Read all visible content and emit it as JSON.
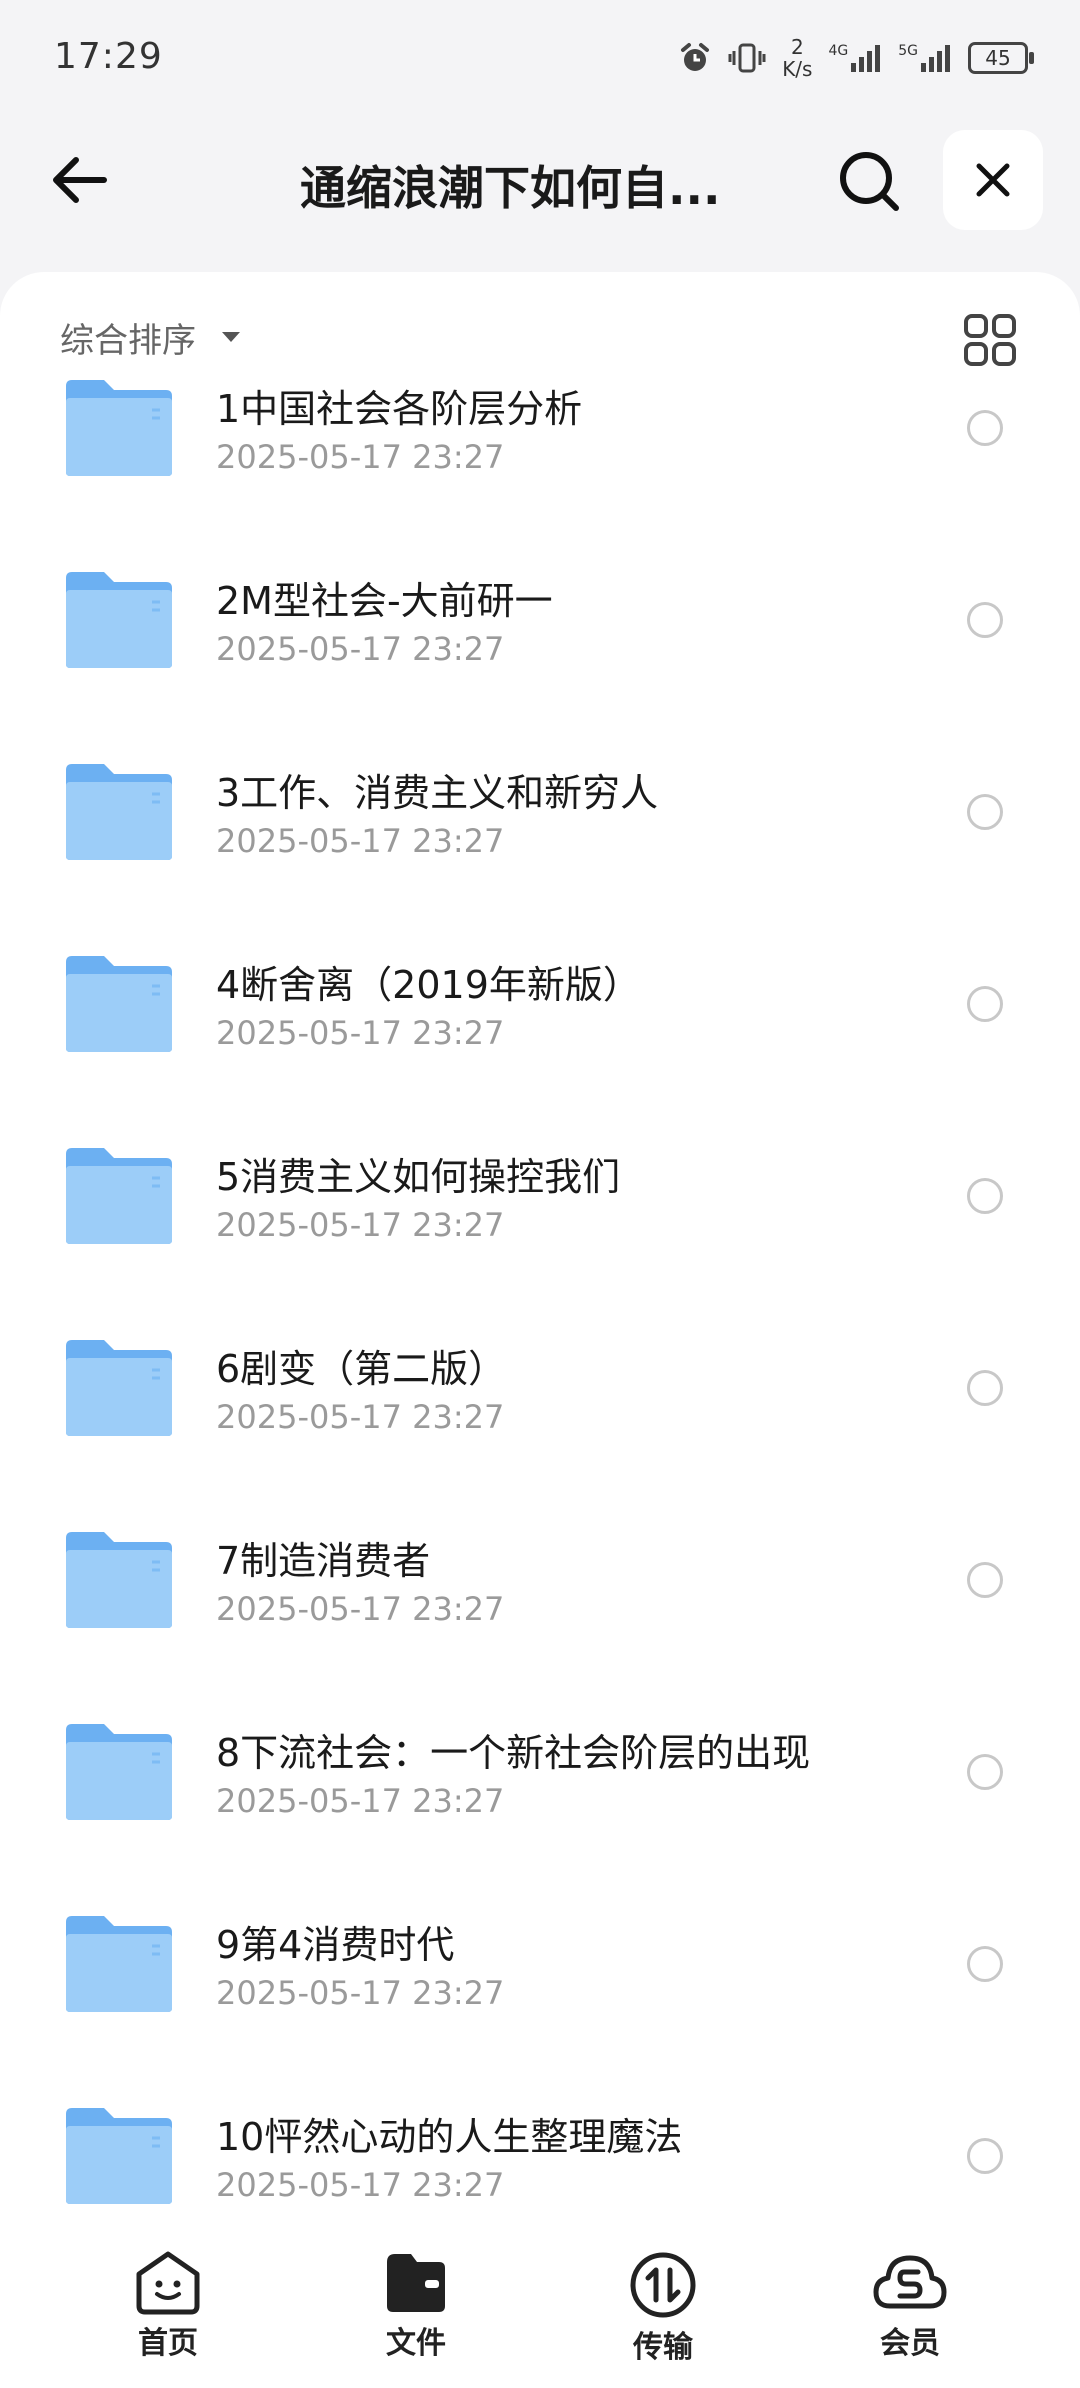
{
  "status_bar": {
    "time": "17:29",
    "net_speed_value": "2",
    "net_speed_unit": "K/s",
    "signal1_label": "4G",
    "signal2_label": "5G",
    "battery": "45"
  },
  "header": {
    "title": "通缩浪潮下如何自...",
    "icons": [
      "back-arrow-icon",
      "search-icon",
      "close-icon"
    ]
  },
  "toolbar": {
    "sort_label": "综合排序",
    "view_toggle_icon": "grid-view-icon"
  },
  "files": [
    {
      "name": "1中国社会各阶层分析",
      "date": "2025-05-17 23:27"
    },
    {
      "name": "2M型社会-大前研一",
      "date": "2025-05-17 23:27"
    },
    {
      "name": "3工作、消费主义和新穷人",
      "date": "2025-05-17 23:27"
    },
    {
      "name": "4断舍离（2019年新版）",
      "date": "2025-05-17 23:27"
    },
    {
      "name": "5消费主义如何操控我们",
      "date": "2025-05-17 23:27"
    },
    {
      "name": "6剧变（第二版）",
      "date": "2025-05-17 23:27"
    },
    {
      "name": "7制造消费者",
      "date": "2025-05-17 23:27"
    },
    {
      "name": "8下流社会：一个新社会阶层的出现",
      "date": "2025-05-17 23:27"
    },
    {
      "name": "9第4消费时代",
      "date": "2025-05-17 23:27"
    },
    {
      "name": "10怦然心动的人生整理魔法",
      "date": "2025-05-17 23:27"
    }
  ],
  "bottom_nav": [
    {
      "label": "首页",
      "icon": "home-face-icon"
    },
    {
      "label": "文件",
      "icon": "folder-wallet-icon",
      "active": true
    },
    {
      "label": "传输",
      "icon": "transfer-icon"
    },
    {
      "label": "会员",
      "icon": "vip-cloud-icon"
    }
  ],
  "colors": {
    "background": "#f4f4f6",
    "folder_light": "#9ccdf8",
    "folder_dark": "#6cb0f2",
    "text_primary": "#1a1a1a",
    "text_secondary": "#9a9a9a"
  }
}
